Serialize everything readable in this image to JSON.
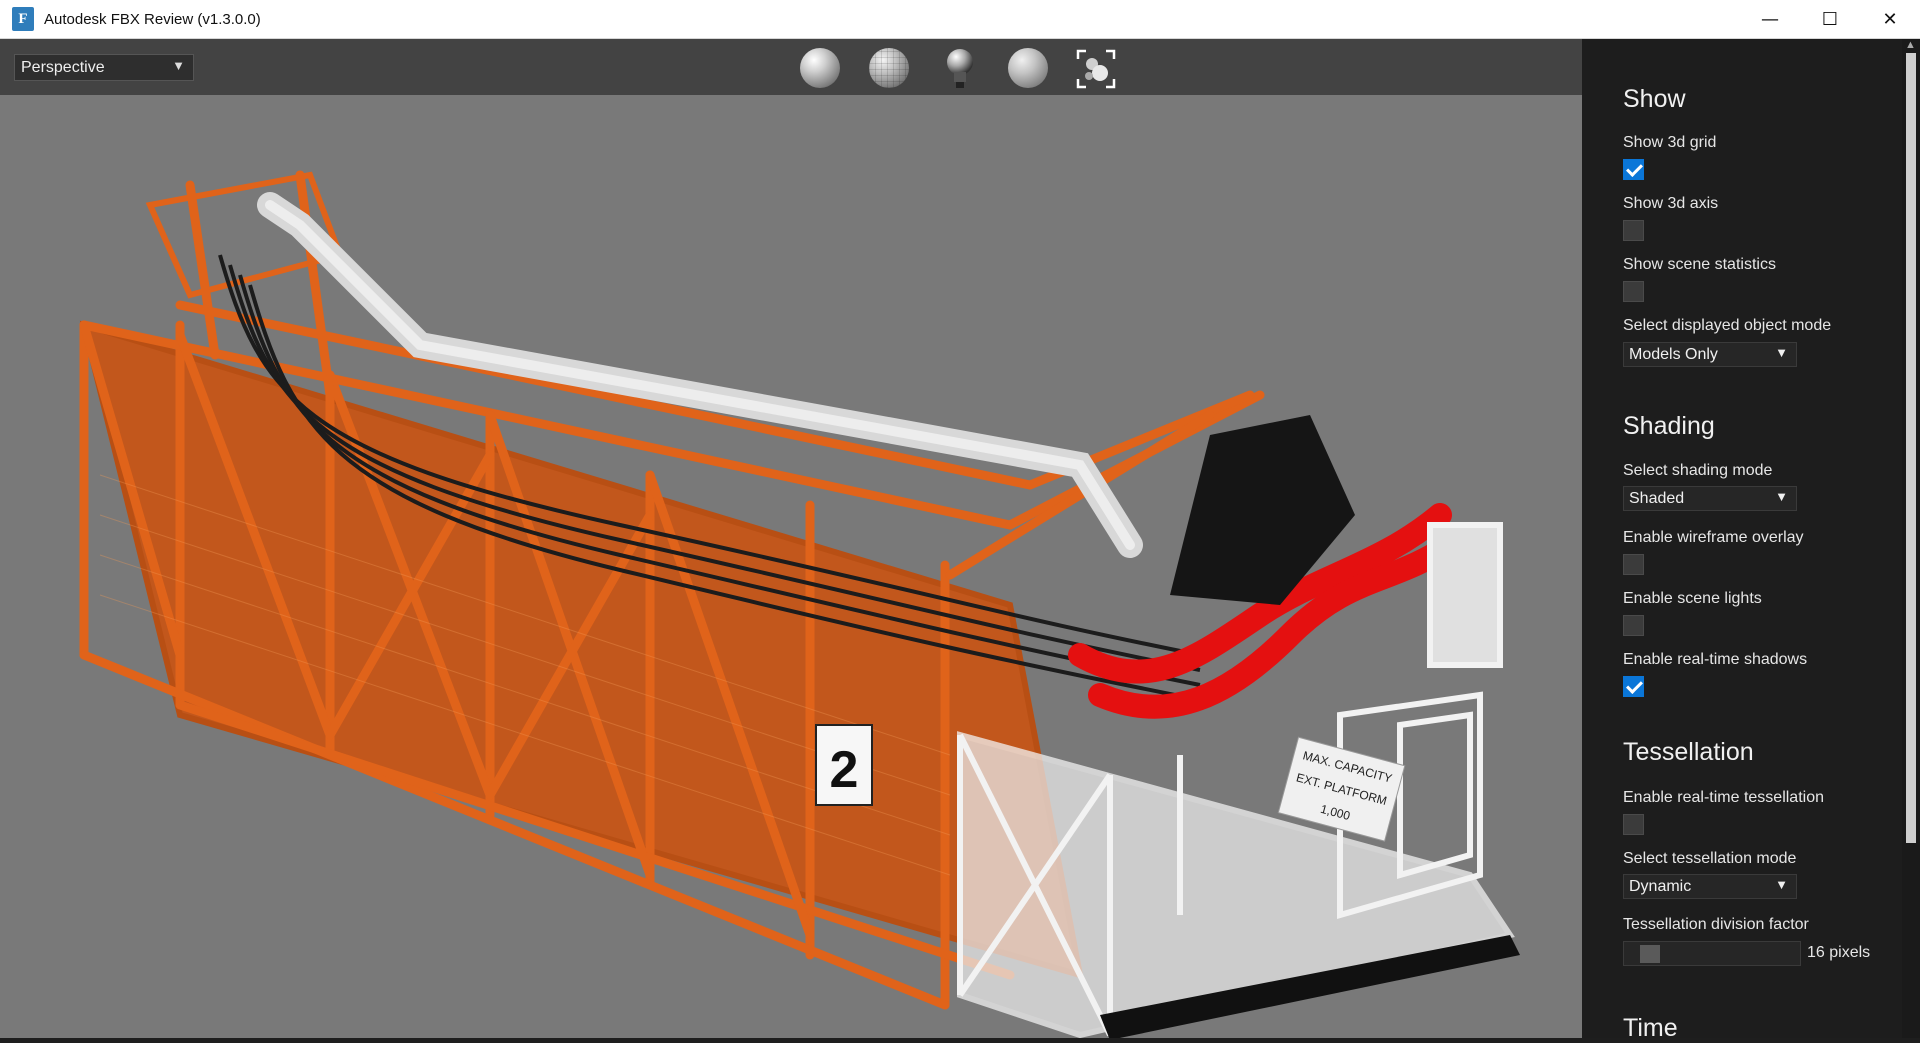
{
  "window": {
    "title": "Autodesk FBX Review (v1.3.0.0)",
    "app_icon_letter": "F",
    "minimize_glyph": "—",
    "maximize_glyph": "☐",
    "close_glyph": "✕"
  },
  "viewport": {
    "camera_select": "Perspective",
    "toolbar_icons": [
      "shaded-sphere-icon",
      "wireframe-sphere-icon",
      "light-bulb-icon",
      "faceted-sphere-icon",
      "frame-all-icon"
    ],
    "model_labels": {
      "floor_number": "2",
      "sign_line1": "MAX. CAPACITY",
      "sign_line2": "EXT. PLATFORM",
      "sign_line3": "1,000"
    }
  },
  "panel": {
    "show": {
      "heading": "Show",
      "grid_label": "Show 3d grid",
      "grid_checked": true,
      "axis_label": "Show 3d axis",
      "axis_checked": false,
      "stats_label": "Show scene statistics",
      "stats_checked": false,
      "object_mode_label": "Select displayed object mode",
      "object_mode_value": "Models Only"
    },
    "shading": {
      "heading": "Shading",
      "mode_label": "Select shading mode",
      "mode_value": "Shaded",
      "wireframe_label": "Enable wireframe overlay",
      "wireframe_checked": false,
      "lights_label": "Enable scene lights",
      "lights_checked": false,
      "shadows_label": "Enable real-time shadows",
      "shadows_checked": true
    },
    "tessellation": {
      "heading": "Tessellation",
      "realtime_label": "Enable real-time tessellation",
      "realtime_checked": false,
      "mode_label": "Select tessellation mode",
      "mode_value": "Dynamic",
      "factor_label": "Tessellation division factor",
      "factor_value": "16 pixels"
    },
    "time": {
      "heading": "Time"
    }
  },
  "colors": {
    "frame_orange": "#e0631a",
    "panel_bg": "#1d1d1d",
    "viewport_bg": "#797979",
    "checkbox_accent": "#0a76d8"
  }
}
